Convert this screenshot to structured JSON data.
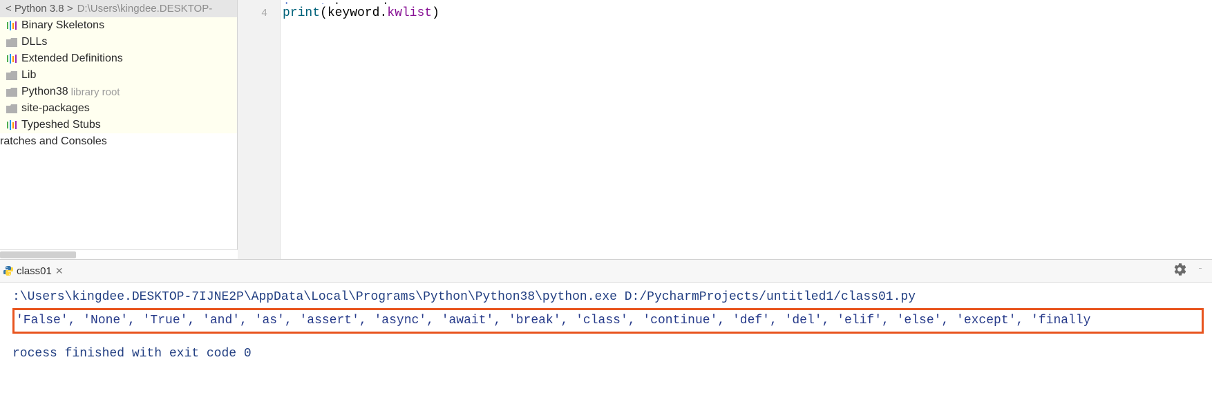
{
  "sidebar": {
    "header_prefix": "< Python 3.8 >",
    "header_path": "D:\\Users\\kingdee.DESKTOP-",
    "items": [
      {
        "label": "Binary Skeletons",
        "icon": "stub"
      },
      {
        "label": "DLLs",
        "icon": "folder"
      },
      {
        "label": "Extended Definitions",
        "icon": "stub"
      },
      {
        "label": "Lib",
        "icon": "folder"
      },
      {
        "label": "Python38",
        "icon": "folder",
        "suffix": "library root"
      },
      {
        "label": "site-packages",
        "icon": "folder"
      },
      {
        "label": "Typeshed Stubs",
        "icon": "stub"
      }
    ],
    "outer_item": "ratches and Consoles"
  },
  "editor": {
    "gutter_top_hidden": "",
    "line_number": "4",
    "code_line_top_kw": "import",
    "code_line_top_id": " keyword",
    "code_print": "print",
    "open_paren": "(",
    "keyword_id": "keyword",
    "dot": ".",
    "kwlist_attr": "kwlist",
    "close_paren": ")"
  },
  "console": {
    "tab_name": "class01",
    "command_line": ":\\Users\\kingdee.DESKTOP-7IJNE2P\\AppData\\Local\\Programs\\Python\\Python38\\python.exe D:/PycharmProjects/untitled1/class01.py",
    "kwlist_output": "'False', 'None', 'True', 'and', 'as', 'assert', 'async', 'await', 'break', 'class', 'continue', 'def', 'del', 'elif', 'else', 'except', 'finally",
    "exit_line": "rocess finished with exit code 0"
  }
}
